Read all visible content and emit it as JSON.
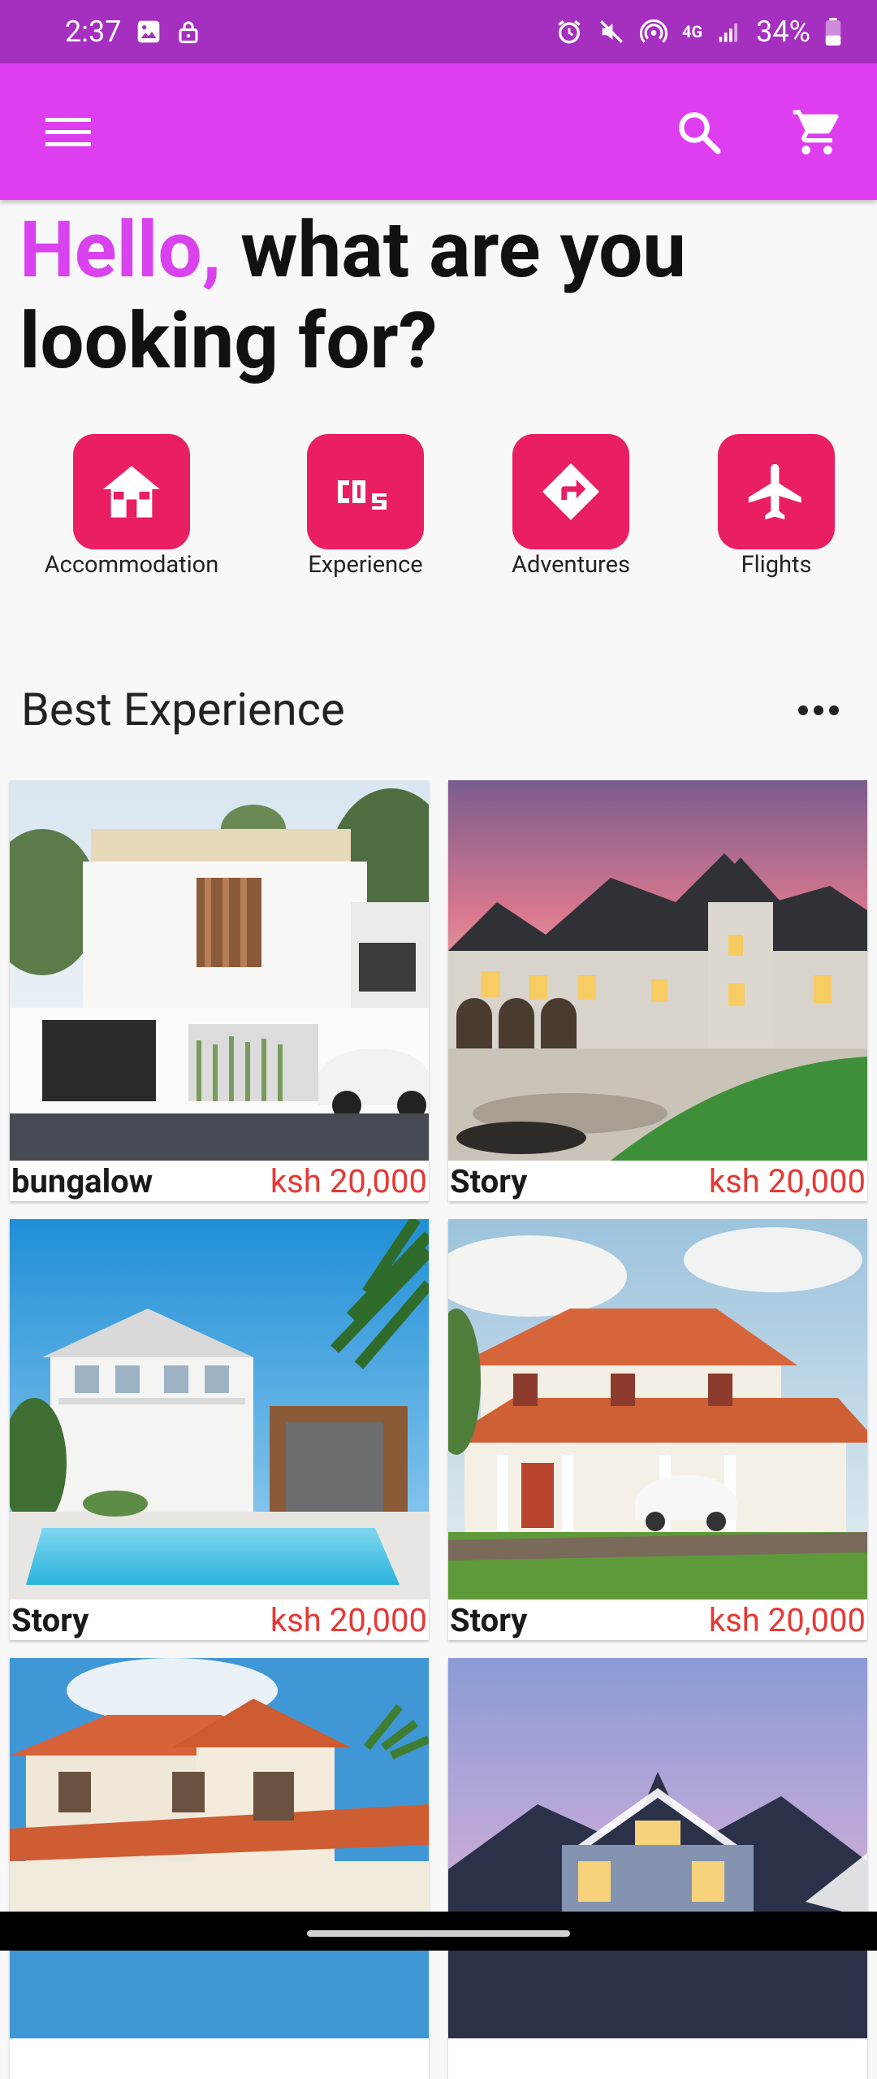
{
  "status_bar": {
    "time": "2:37",
    "battery": "34%",
    "network": "4G"
  },
  "app_bar": {
    "menu_icon": "menu-icon",
    "search_icon": "search-icon",
    "cart_icon": "cart-icon",
    "background": "#df3ef0"
  },
  "greeting": {
    "hello": "Hello,",
    "rest": " what are you looking for?"
  },
  "categories": [
    {
      "label": "Accommodation",
      "icon": "house-icon"
    },
    {
      "label": "Experience",
      "icon": "co2-icon"
    },
    {
      "label": "Adventures",
      "icon": "directions-icon"
    },
    {
      "label": "Flights",
      "icon": "airplane-icon"
    }
  ],
  "section": {
    "title": "Best Experience",
    "more_icon": "more-horiz-icon"
  },
  "listings": [
    {
      "name": "bungalow",
      "price": "ksh 20,000"
    },
    {
      "name": "Story",
      "price": "ksh 20,000"
    },
    {
      "name": "Story",
      "price": "ksh 20,000"
    },
    {
      "name": "Story",
      "price": "ksh 20,000"
    }
  ],
  "colors": {
    "status_bar": "#a52fbf",
    "accent": "#d943ee",
    "category_bg": "#e91e63",
    "price": "#e53935"
  }
}
